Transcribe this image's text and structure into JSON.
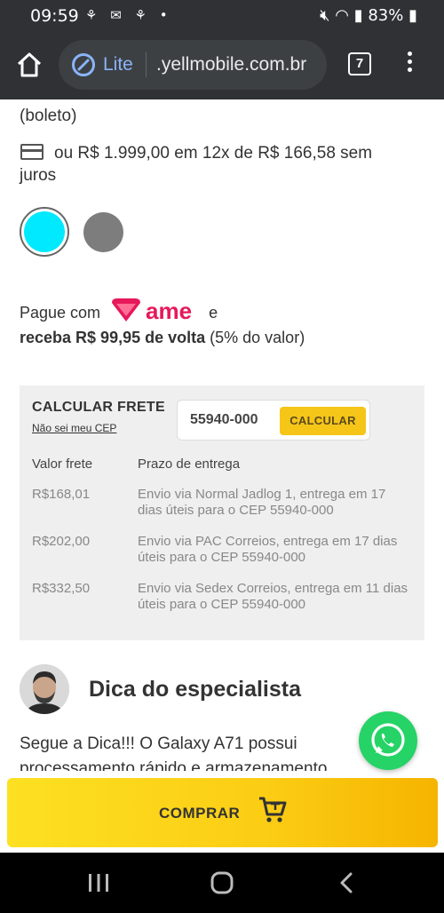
{
  "status_bar": {
    "time": "09:59",
    "battery": "83%"
  },
  "browser": {
    "mode_label": "Lite",
    "url": ".yellmobile.com.br",
    "tab_count": "7"
  },
  "payment": {
    "boleto_text": "(boleto)",
    "installments_text": "ou R$ 1.999,00 em 12x de R$ 166,58 sem juros"
  },
  "color_options": [
    {
      "name": "cyan",
      "color": "#00e9ff",
      "selected": true
    },
    {
      "name": "gray",
      "color": "#7d7d7d",
      "selected": false
    }
  ],
  "ame": {
    "prefix": "Pague com",
    "brand": "ame",
    "suffix": "e",
    "cashback_bold": "receba R$ 99,95 de volta",
    "cashback_note": "(5% do valor)"
  },
  "shipping": {
    "title": "CALCULAR FRETE",
    "unknown_cep_link": "Não sei meu CEP",
    "cep_value": "55940-000",
    "calculate_button": "CALCULAR",
    "col_price": "Valor frete",
    "col_deadline": "Prazo de entrega",
    "options": [
      {
        "price": "R$168,01",
        "description": "Envio via Normal Jadlog 1, entrega em 17 dias úteis para o CEP 55940-000"
      },
      {
        "price": "R$202,00",
        "description": "Envio via PAC Correios, entrega em 17 dias úteis para o CEP 55940-000"
      },
      {
        "price": "R$332,50",
        "description": "Envio via Sedex Correios, entrega em 11 dias úteis para o CEP 55940-000"
      }
    ]
  },
  "tip": {
    "title": "Dica do especialista",
    "text": "Segue a Dica!!! O Galaxy A71 possui processamento rápido e armazenamento"
  },
  "buy_button": {
    "label": "COMPRAR"
  },
  "colors": {
    "accent_yellow": "#f5c518",
    "whatsapp_green": "#25d366",
    "ame_pink": "#e6195a"
  }
}
